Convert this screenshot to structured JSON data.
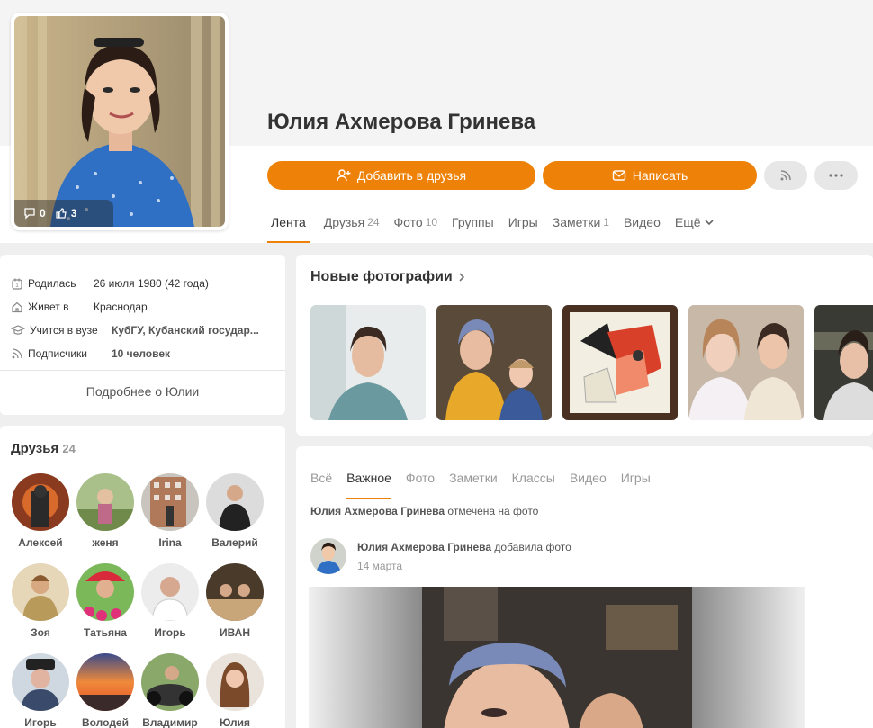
{
  "profile": {
    "name": "Юлия Ахмерова Гринева",
    "avatar_stats": {
      "comments": "0",
      "likes": "3"
    }
  },
  "actions": {
    "add_friend": "Добавить в друзья",
    "message": "Написать"
  },
  "tabs": [
    {
      "label": "Лента",
      "count": ""
    },
    {
      "label": "Друзья",
      "count": "24"
    },
    {
      "label": "Фото",
      "count": "10"
    },
    {
      "label": "Группы",
      "count": ""
    },
    {
      "label": "Игры",
      "count": ""
    },
    {
      "label": "Заметки",
      "count": "1"
    },
    {
      "label": "Видео",
      "count": ""
    },
    {
      "label": "Ещё",
      "count": ""
    }
  ],
  "info": {
    "born_label": "Родилась",
    "born_value": "26 июля 1980 (42 года)",
    "lives_label": "Живет в",
    "lives_value": "Краснодар",
    "study_label": "Учится в вузе",
    "study_value": "КубГУ, Кубанский государ...",
    "subs_label": "Подписчики",
    "subs_value": "10 человек",
    "more": "Подробнее о Юлии"
  },
  "friends": {
    "title": "Друзья",
    "count": "24",
    "items": [
      "Алексей",
      "женя",
      "Irina",
      "Валерий",
      "Зоя",
      "Татьяна",
      "Игорь",
      "ИВАН",
      "Игорь",
      "Володей",
      "Владимир",
      "Юлия"
    ]
  },
  "photos": {
    "title": "Новые фотографии"
  },
  "feed": {
    "tabs": [
      "Всё",
      "Важное",
      "Фото",
      "Заметки",
      "Классы",
      "Видео",
      "Игры"
    ],
    "line1_name": "Юлия Ахмерова Гринева",
    "line1_action": "отмечена на фото",
    "post_name": "Юлия Ахмерова Гринева",
    "post_action": "добавила фото",
    "post_date": "14 марта"
  },
  "colors": {
    "accent": "#ee8208",
    "background": "#efefef"
  }
}
